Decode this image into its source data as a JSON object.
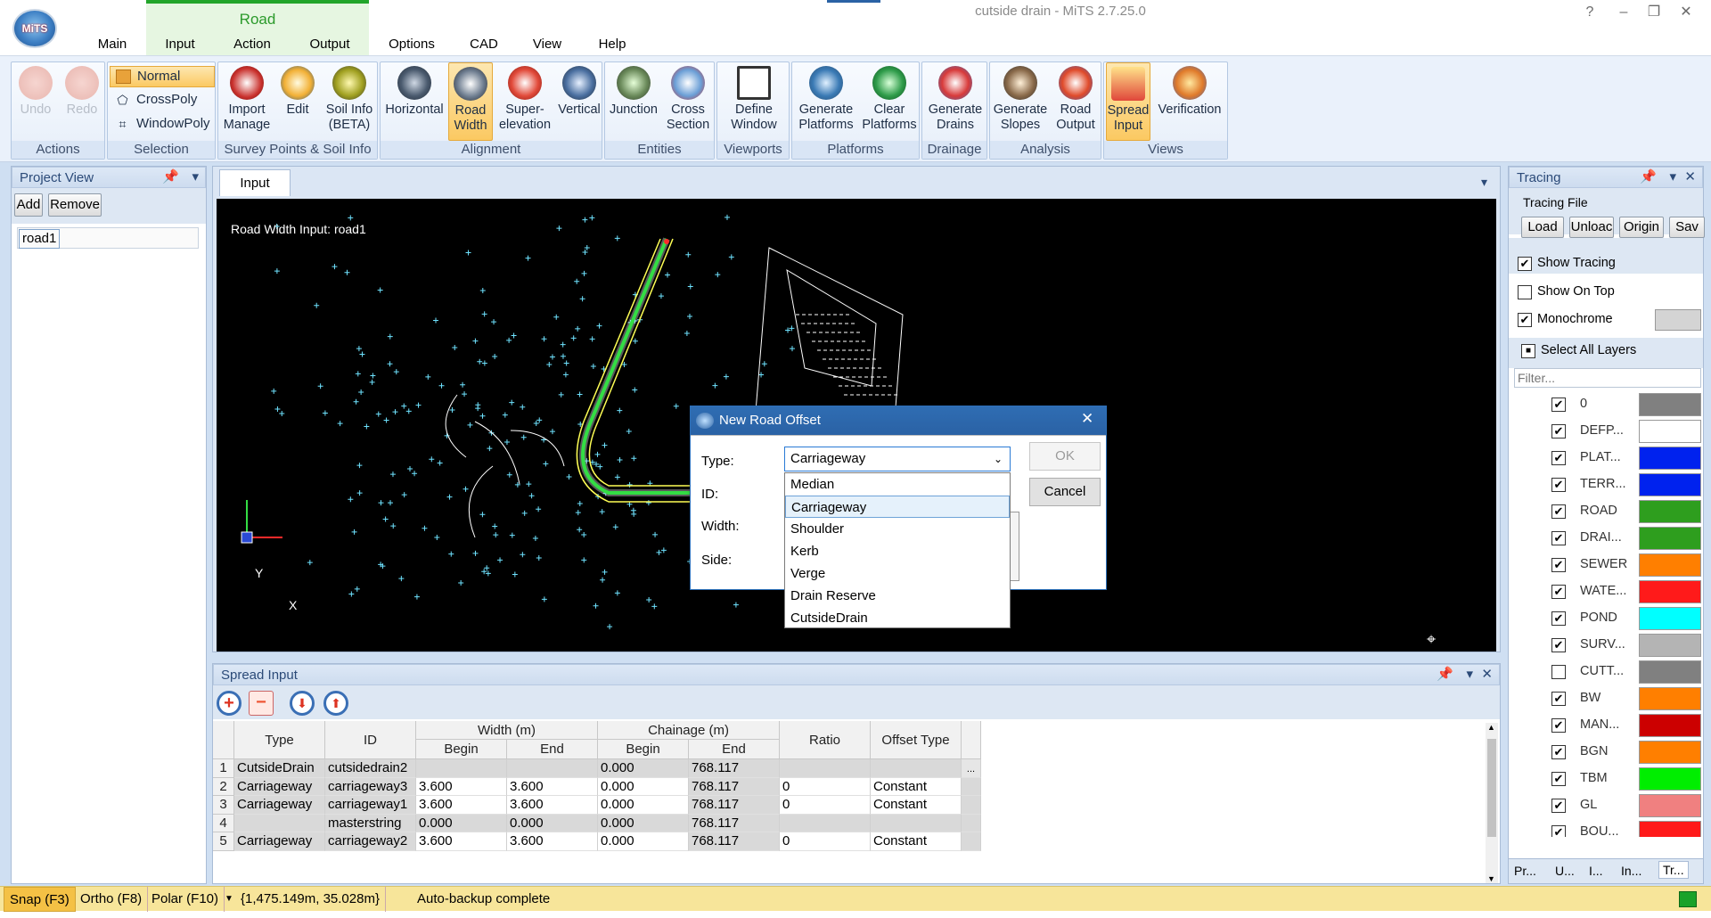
{
  "window": {
    "title": "cutside drain - MiTS 2.7.25.0",
    "controls": [
      "?",
      "–",
      "❐",
      "✕"
    ]
  },
  "app_logo": "MiTS",
  "ribbon_tabs": {
    "context_label": "Road",
    "tabs": [
      "Main",
      "Input",
      "Action",
      "Output",
      "Options",
      "CAD",
      "View",
      "Help"
    ]
  },
  "ribbon": {
    "actions": {
      "caption": "Actions",
      "undo": "Undo",
      "redo": "Redo"
    },
    "selection": {
      "caption": "Selection",
      "normal": "Normal",
      "crosspoly": "CrossPoly",
      "windowpoly": "WindowPoly"
    },
    "survey": {
      "caption": "Survey Points & Soil Info",
      "import_manage": "Import\nManage",
      "edit": "Edit",
      "soil_info": "Soil Info\n(BETA)"
    },
    "alignment": {
      "caption": "Alignment",
      "horizontal": "Horizontal",
      "road_width": "Road\nWidth",
      "superelevation": "Super-\nelevation",
      "vertical": "Vertical"
    },
    "entities": {
      "caption": "Entities",
      "junction": "Junction",
      "cross_section": "Cross\nSection"
    },
    "viewports": {
      "caption": "Viewports",
      "define_window": "Define\nWindow"
    },
    "platforms": {
      "caption": "Platforms",
      "generate_platforms": "Generate\nPlatforms",
      "clear_platforms": "Clear\nPlatforms"
    },
    "drainage": {
      "caption": "Drainage",
      "generate_drains": "Generate\nDrains"
    },
    "analysis": {
      "caption": "Analysis",
      "generate_slopes": "Generate\nSlopes",
      "road_output": "Road\nOutput"
    },
    "views": {
      "caption": "Views",
      "spread_input": "Spread\nInput",
      "verification": "Verification"
    }
  },
  "project_view": {
    "title": "Project View",
    "add": "Add",
    "remove": "Remove",
    "items": [
      "road1"
    ]
  },
  "doc_tab": {
    "label": "Input"
  },
  "canvas": {
    "caption": "Road Width Input: road1",
    "axis_y": "Y",
    "axis_x": "X"
  },
  "dialog": {
    "title": "New Road Offset",
    "type_label": "Type:",
    "id_label": "ID:",
    "width_label": "Width:",
    "side_label": "Side:",
    "type_value": "Carriageway",
    "ok": "OK",
    "cancel": "Cancel",
    "options": [
      "Median",
      "Carriageway",
      "Shoulder",
      "Kerb",
      "Verge",
      "Drain Reserve",
      "CutsideDrain"
    ],
    "selected_option": "Carriageway"
  },
  "spread_input": {
    "title": "Spread Input",
    "headers": {
      "type": "Type",
      "id": "ID",
      "width": "Width (m)",
      "chainage": "Chainage (m)",
      "begin": "Begin",
      "end": "End",
      "ratio": "Ratio",
      "offset_type": "Offset Type"
    },
    "rows": [
      {
        "n": "1",
        "type": "CutsideDrain",
        "id": "cutsidedrain2",
        "wb": "",
        "we": "",
        "cb": "0.000",
        "ce": "768.117",
        "ratio": "",
        "ot": ""
      },
      {
        "n": "2",
        "type": "Carriageway",
        "id": "carriageway3",
        "wb": "3.600",
        "we": "3.600",
        "cb": "0.000",
        "ce": "768.117",
        "ratio": "0",
        "ot": "Constant"
      },
      {
        "n": "3",
        "type": "Carriageway",
        "id": "carriageway1",
        "wb": "3.600",
        "we": "3.600",
        "cb": "0.000",
        "ce": "768.117",
        "ratio": "0",
        "ot": "Constant"
      },
      {
        "n": "4",
        "type": "",
        "id": "masterstring",
        "wb": "0.000",
        "we": "0.000",
        "cb": "0.000",
        "ce": "768.117",
        "ratio": "",
        "ot": ""
      },
      {
        "n": "5",
        "type": "Carriageway",
        "id": "carriageway2",
        "wb": "3.600",
        "we": "3.600",
        "cb": "0.000",
        "ce": "768.117",
        "ratio": "0",
        "ot": "Constant"
      }
    ],
    "ellipsis": "..."
  },
  "tracing": {
    "title": "Tracing",
    "file_label": "Tracing File",
    "load": "Load",
    "unload": "Unloac",
    "origin": "Origin",
    "save": "Sav",
    "show_tracing": "Show Tracing",
    "show_on_top": "Show On Top",
    "monochrome": "Monochrome",
    "select_all_layers": "Select All Layers",
    "filter_placeholder": "Filter...",
    "layers": [
      {
        "name": "0",
        "checked": true,
        "color": "#808080"
      },
      {
        "name": "DEFP...",
        "checked": true,
        "color": "#ffffff"
      },
      {
        "name": "PLAT...",
        "checked": true,
        "color": "#0022ee"
      },
      {
        "name": "TERR...",
        "checked": true,
        "color": "#0022ee"
      },
      {
        "name": "ROAD",
        "checked": true,
        "color": "#2e9e1e"
      },
      {
        "name": "DRAI...",
        "checked": true,
        "color": "#2e9e1e"
      },
      {
        "name": "SEWER",
        "checked": true,
        "color": "#ff7f00"
      },
      {
        "name": "WATE...",
        "checked": true,
        "color": "#ff1a1a"
      },
      {
        "name": "POND",
        "checked": true,
        "color": "#00ffff"
      },
      {
        "name": "SURV...",
        "checked": true,
        "color": "#b4b4b4"
      },
      {
        "name": "CUTT...",
        "checked": false,
        "color": "#808080"
      },
      {
        "name": "BW",
        "checked": true,
        "color": "#ff7f00"
      },
      {
        "name": "MAN...",
        "checked": true,
        "color": "#cc0000"
      },
      {
        "name": "BGN",
        "checked": true,
        "color": "#ff7f00"
      },
      {
        "name": "TBM",
        "checked": true,
        "color": "#00ee00"
      },
      {
        "name": "GL",
        "checked": true,
        "color": "#f08080"
      },
      {
        "name": "BOU...",
        "checked": true,
        "color": "#ff1a1a"
      }
    ],
    "bottom_tabs": [
      "Pr...",
      "U...",
      "I...",
      "In...",
      "Tr..."
    ]
  },
  "status": {
    "snap": "Snap (F3)",
    "ortho": "Ortho (F8)",
    "polar": "Polar (F10)",
    "coords": "{1,475.149m, 35.028m}",
    "message": "Auto-backup complete"
  }
}
